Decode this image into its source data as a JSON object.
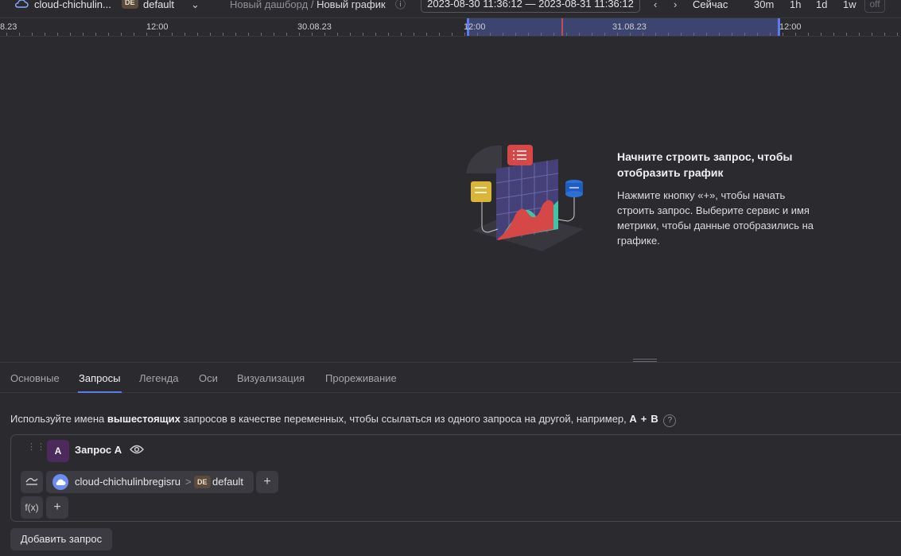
{
  "header": {
    "folder": "cloud-chichulin...",
    "folder_badge": "DE",
    "folder_default": "default",
    "breadcrumb_dashboard": "Новый дашборд",
    "breadcrumb_sep": "/",
    "breadcrumb_chart": "Новый график",
    "time_range": "2023-08-30 11:36:12 — 2023-08-31 11:36:12",
    "now_label": "Сейчас",
    "presets": [
      "30m",
      "1h",
      "1d",
      "1w"
    ],
    "off_label": "off"
  },
  "timeline": {
    "labels": [
      "8.23",
      "12:00",
      "30.08.23",
      "12:00",
      "31.08.23",
      "12:00"
    ]
  },
  "empty_state": {
    "title": "Начните строить запрос, чтобы отобразить график",
    "description": "Нажмите кнопку «+», чтобы начать строить запрос. Выберите сервис и имя метрики, чтобы данные отобразились на графике."
  },
  "tabs": [
    "Основные",
    "Запросы",
    "Легенда",
    "Оси",
    "Визуализация",
    "Прореживание"
  ],
  "hint": {
    "prefix": "Используйте имена",
    "bold": "вышестоящих",
    "suffix": "запросов в качестве переменных, чтобы ссылаться из одного запроса на другой, например,",
    "var_a": "A",
    "op": "+",
    "var_b": "B",
    "help": "?"
  },
  "query": {
    "badge": "A",
    "name": "Запрос A",
    "folder": "cloud-chichulinbregisru",
    "separator": ">",
    "folder_badge": "DE",
    "folder_default": "default",
    "fx_label": "f(x)"
  },
  "add_query_label": "Добавить запрос",
  "colors": {
    "accent": "#5b7cf0",
    "selection": "#3c4470",
    "now_marker": "#c24b5a"
  }
}
